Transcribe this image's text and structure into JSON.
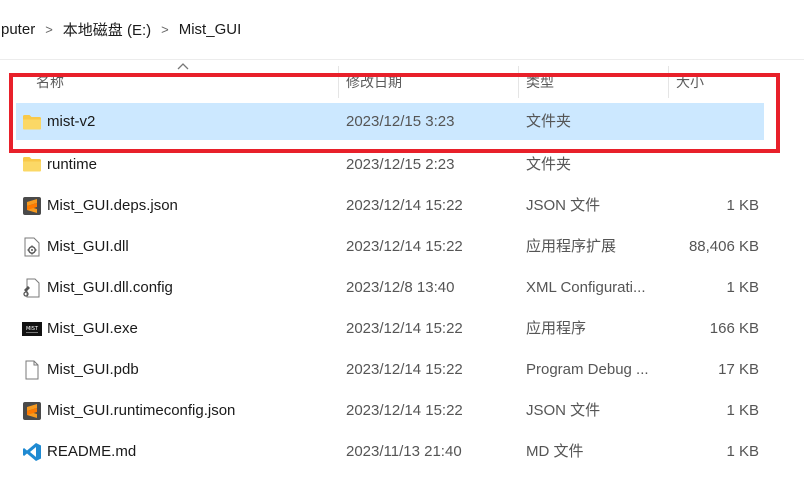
{
  "breadcrumb": {
    "items": [
      "puter",
      "本地磁盘 (E:)",
      "Mist_GUI"
    ],
    "separator": ">"
  },
  "columns": {
    "name": "名称",
    "date": "修改日期",
    "type": "类型",
    "size": "大小"
  },
  "files": [
    {
      "name": "mist-v2",
      "date": "2023/12/15 3:23",
      "type": "文件夹",
      "size": "",
      "icon": "folder-icon"
    },
    {
      "name": "runtime",
      "date": "2023/12/15 2:23",
      "type": "文件夹",
      "size": "",
      "icon": "folder-icon"
    },
    {
      "name": "Mist_GUI.deps.json",
      "date": "2023/12/14 15:22",
      "type": "JSON 文件",
      "size": "1 KB",
      "icon": "sublime-icon"
    },
    {
      "name": "Mist_GUI.dll",
      "date": "2023/12/14 15:22",
      "type": "应用程序扩展",
      "size": "88,406 KB",
      "icon": "dll-icon"
    },
    {
      "name": "Mist_GUI.dll.config",
      "date": "2023/12/8 13:40",
      "type": "XML Configurati...",
      "size": "1 KB",
      "icon": "config-icon"
    },
    {
      "name": "Mist_GUI.exe",
      "date": "2023/12/14 15:22",
      "type": "应用程序",
      "size": "166 KB",
      "icon": "exe-icon"
    },
    {
      "name": "Mist_GUI.pdb",
      "date": "2023/12/14 15:22",
      "type": "Program Debug ...",
      "size": "17 KB",
      "icon": "file-icon"
    },
    {
      "name": "Mist_GUI.runtimeconfig.json",
      "date": "2023/12/14 15:22",
      "type": "JSON 文件",
      "size": "1 KB",
      "icon": "sublime-icon"
    },
    {
      "name": "README.md",
      "date": "2023/11/13 21:40",
      "type": "MD 文件",
      "size": "1 KB",
      "icon": "vscode-icon"
    }
  ],
  "selected_index": 0,
  "colors": {
    "selection": "#cce8ff",
    "annotation_box": "#e8202a",
    "folder": "#f8c94a"
  }
}
